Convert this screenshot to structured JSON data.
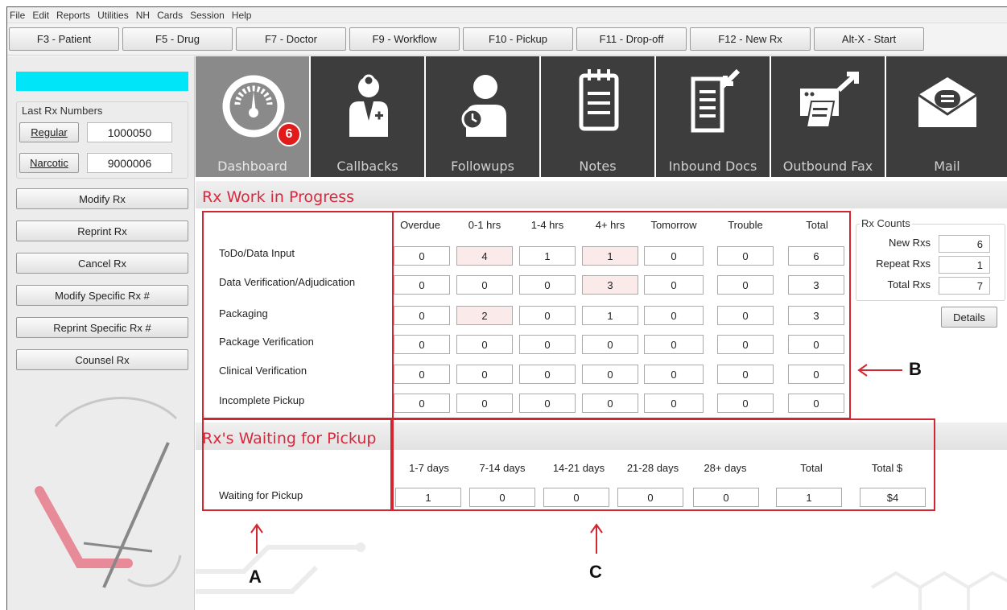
{
  "menu": [
    "File",
    "Edit",
    "Reports",
    "Utilities",
    "NH",
    "Cards",
    "Session",
    "Help"
  ],
  "fkeys": [
    "F3 - Patient",
    "F5 - Drug",
    "F7 - Doctor",
    "F9 - Workflow",
    "F10 - Pickup",
    "F11 - Drop-off",
    "F12 - New Rx",
    "Alt-X - Start"
  ],
  "left": {
    "last_rx_title": "Last Rx Numbers",
    "regular_label": "Regular",
    "regular_value": "1000050",
    "narcotic_label": "Narcotic",
    "narcotic_value": "9000006",
    "actions": [
      "Modify Rx",
      "Reprint Rx",
      "Cancel Rx",
      "Modify Specific Rx #",
      "Reprint Specific Rx #",
      "Counsel Rx"
    ]
  },
  "tiles": [
    {
      "label": "Dashboard",
      "icon": "gauge-icon"
    },
    {
      "label": "Callbacks",
      "icon": "doctor-icon"
    },
    {
      "label": "Followups",
      "icon": "person-clock-icon"
    },
    {
      "label": "Notes",
      "icon": "notepad-icon"
    },
    {
      "label": "Inbound Docs",
      "icon": "document-inbound-icon"
    },
    {
      "label": "Outbound Fax",
      "icon": "fax-icon"
    },
    {
      "label": "Mail",
      "icon": "envelope-icon"
    }
  ],
  "dashboard_badge": "6",
  "wip": {
    "title": "Rx Work in Progress",
    "columns": [
      "Overdue",
      "0-1 hrs",
      "1-4 hrs",
      "4+ hrs",
      "Tomorrow",
      "Trouble",
      "Total"
    ],
    "rows": [
      {
        "label": "ToDo/Data Input",
        "values": [
          "0",
          "4",
          "1",
          "1",
          "0",
          "0",
          "6"
        ]
      },
      {
        "label": "Data Verification/Adjudication",
        "values": [
          "0",
          "0",
          "0",
          "3",
          "0",
          "0",
          "3"
        ]
      },
      {
        "label": "Packaging",
        "values": [
          "0",
          "2",
          "0",
          "1",
          "0",
          "0",
          "3"
        ]
      },
      {
        "label": "Package Verification",
        "values": [
          "0",
          "0",
          "0",
          "0",
          "0",
          "0",
          "0"
        ]
      },
      {
        "label": "Clinical Verification",
        "values": [
          "0",
          "0",
          "0",
          "0",
          "0",
          "0",
          "0"
        ]
      },
      {
        "label": "Incomplete Pickup",
        "values": [
          "0",
          "0",
          "0",
          "0",
          "0",
          "0",
          "0"
        ]
      }
    ]
  },
  "rx_counts": {
    "title": "Rx Counts",
    "new_label": "New Rxs",
    "new_value": "6",
    "repeat_label": "Repeat Rxs",
    "repeat_value": "1",
    "total_label": "Total Rxs",
    "total_value": "7",
    "details_label": "Details"
  },
  "pickup": {
    "title": "Rx's Waiting for Pickup",
    "columns": [
      "1-7 days",
      "7-14 days",
      "14-21 days",
      "21-28 days",
      "28+ days",
      "Total",
      "Total $"
    ],
    "row_label": "Waiting for Pickup",
    "values": [
      "1",
      "0",
      "0",
      "0",
      "0",
      "1",
      "$4"
    ]
  },
  "annotations": {
    "a": "A",
    "b": "B",
    "c": "C"
  },
  "colors": {
    "accent_red": "#d8283c",
    "cyan": "#00e5f7",
    "tile_dark": "#3d3d3d",
    "tile_active": "#8a8a8a"
  }
}
